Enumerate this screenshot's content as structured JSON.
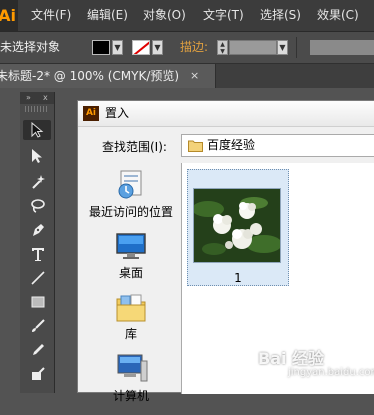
{
  "app": {
    "logo": "Ai"
  },
  "menubar": {
    "items": [
      {
        "label": "文件(F)"
      },
      {
        "label": "编辑(E)"
      },
      {
        "label": "对象(O)"
      },
      {
        "label": "文字(T)"
      },
      {
        "label": "选择(S)"
      },
      {
        "label": "效果(C)"
      }
    ]
  },
  "control_bar": {
    "selection_status": "未选择对象",
    "fill_color": "#000000",
    "stroke_label": "描边:",
    "stroke_label_color": "#e0a040"
  },
  "document_tab": {
    "label": "未标题-2* @ 100% (CMYK/预览)",
    "close_glyph": "×"
  },
  "tools_panel": {
    "collapse_glyph": "»",
    "close_glyph": "x",
    "tools": [
      {
        "name": "selection-tool-icon",
        "active": true
      },
      {
        "name": "direct-selection-tool-icon",
        "active": false
      },
      {
        "name": "magic-wand-tool-icon",
        "active": false
      },
      {
        "name": "lasso-tool-icon",
        "active": false
      },
      {
        "name": "pen-tool-icon",
        "active": false
      },
      {
        "name": "type-tool-icon",
        "active": false
      },
      {
        "name": "line-segment-tool-icon",
        "active": false
      },
      {
        "name": "rectangle-tool-icon",
        "active": false
      },
      {
        "name": "paintbrush-tool-icon",
        "active": false
      },
      {
        "name": "pencil-tool-icon",
        "active": false
      },
      {
        "name": "blob-brush-tool-icon",
        "active": false
      }
    ]
  },
  "dialog": {
    "icon_text": "Ai",
    "title": "置入",
    "look_in_label": "查找范围(I):",
    "look_in_value": "百度经验",
    "places": [
      {
        "label": "最近访问的位置",
        "icon": "recent-places-icon"
      },
      {
        "label": "桌面",
        "icon": "desktop-icon"
      },
      {
        "label": "库",
        "icon": "libraries-icon"
      },
      {
        "label": "计算机",
        "icon": "computer-icon"
      }
    ],
    "files": [
      {
        "name": "1",
        "selected": true,
        "thumbnail": "white-flowers-thumbnail"
      }
    ]
  },
  "watermark": {
    "brand": "Bai 经验",
    "url": "jingyan.baidu.com"
  }
}
